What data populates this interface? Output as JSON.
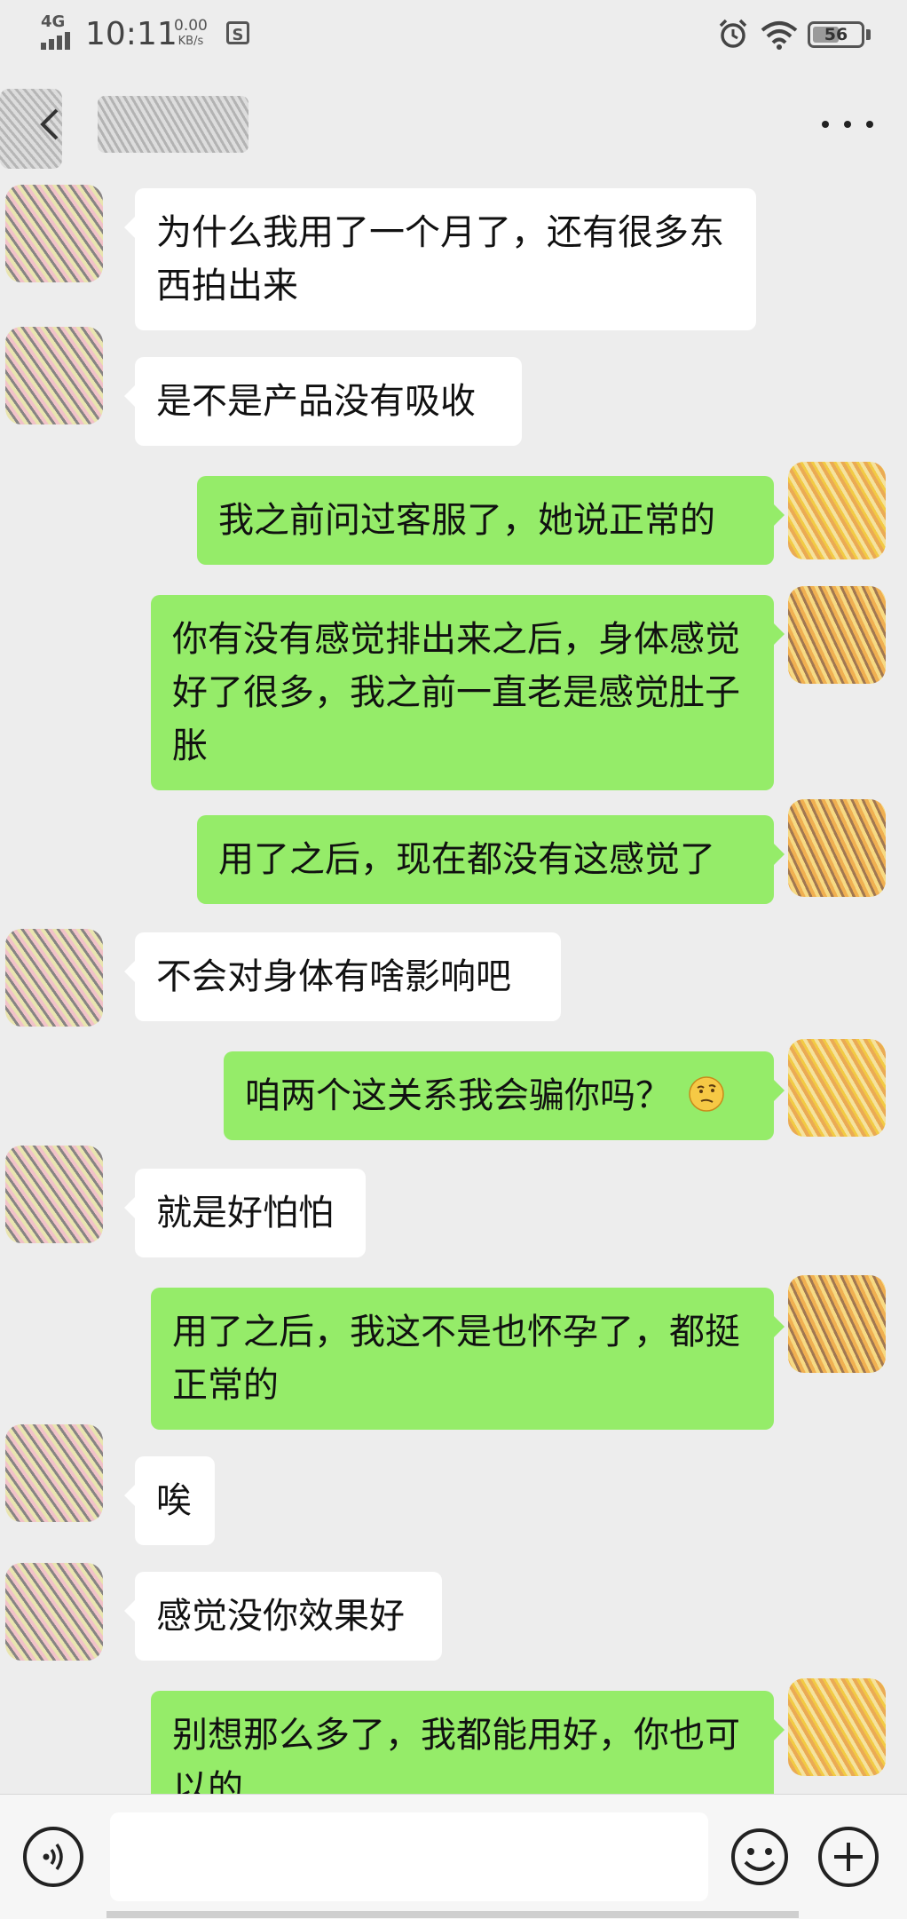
{
  "status_bar": {
    "network": "4G",
    "time": "10:11",
    "speed_value": "0.00",
    "speed_unit": "KB/s",
    "sim_icon": "S",
    "battery_level": "56",
    "battery_fraction": 0.56,
    "icons": [
      "signal-icon",
      "alarm-icon",
      "wifi-icon",
      "battery-icon"
    ]
  },
  "header": {
    "back_icon": "chevron-left-icon",
    "more_icon": "more-icon"
  },
  "messages": [
    {
      "side": "in",
      "text": "为什么我用了一个月了，还有很多东西拍出来"
    },
    {
      "side": "in",
      "text": "是不是产品没有吸收"
    },
    {
      "side": "out",
      "text": "我之前问过客服了，她说正常的"
    },
    {
      "side": "out",
      "text": "你有没有感觉排出来之后，身体感觉好了很多，我之前一直老是感觉肚子胀"
    },
    {
      "side": "out",
      "text": "用了之后，现在都没有这感觉了"
    },
    {
      "side": "in",
      "text": "不会对身体有啥影响吧"
    },
    {
      "side": "out",
      "text": "咱两个这关系我会骗你吗？",
      "emoji": "thinking-face-icon"
    },
    {
      "side": "in",
      "text": "就是好怕怕"
    },
    {
      "side": "out",
      "text": "用了之后，我这不是也怀孕了，都挺正常的"
    },
    {
      "side": "in",
      "text": "唉"
    },
    {
      "side": "in",
      "text": "感觉没你效果好"
    },
    {
      "side": "out",
      "text": "别想那么多了，我都能用好，你也可以的"
    }
  ],
  "input_bar": {
    "voice_icon": "voice-icon",
    "input_value": "",
    "emoji_icon": "emoji-icon",
    "plus_icon": "plus-icon"
  },
  "colors": {
    "background": "#ededed",
    "incoming_bubble": "#ffffff",
    "outgoing_bubble": "#95ec69",
    "input_bar": "#f6f6f6"
  }
}
